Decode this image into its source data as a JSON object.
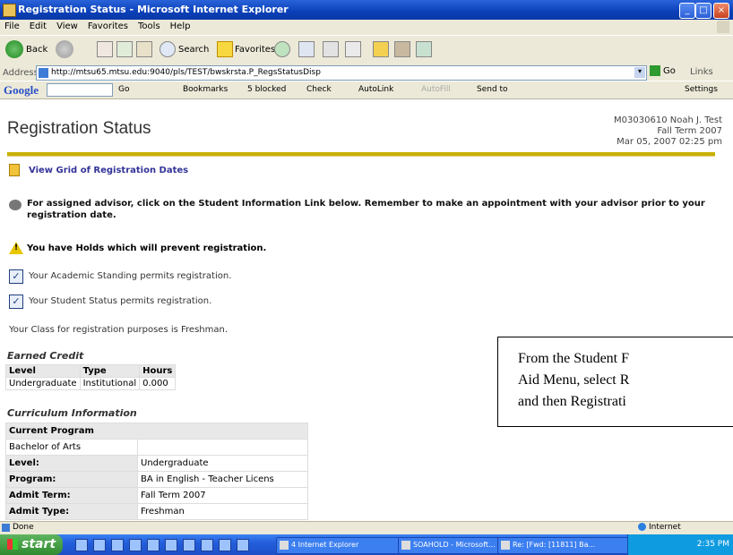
{
  "window": {
    "title": "Registration Status - Microsoft Internet Explorer"
  },
  "menu": [
    "File",
    "Edit",
    "View",
    "Favorites",
    "Tools",
    "Help"
  ],
  "toolbar": {
    "back": "Back",
    "search": "Search",
    "favorites": "Favorites"
  },
  "address": {
    "label": "Address",
    "url": "http://mtsu65.mtsu.edu:9040/pls/TEST/bwskrsta.P_RegsStatusDisp",
    "go": "Go",
    "links": "Links"
  },
  "google": {
    "logo": "Google",
    "go": "Go",
    "bookmarks": "Bookmarks",
    "blocked": "5 blocked",
    "check": "Check",
    "autolink": "AutoLink",
    "autofill": "AutoFill",
    "sendto": "Send to",
    "settings": "Settings"
  },
  "page": {
    "title": "Registration Status",
    "user": "M03030610 Noah J. Test",
    "term": "Fall Term 2007",
    "datetime": "Mar 05, 2007 02:25 pm",
    "grid_link": "View Grid of Registration Dates",
    "advisor_note": "For assigned advisor, click on the Student Information Link below. Remember to make an appointment with your advisor prior to your registration date.",
    "holds": "You have Holds which will prevent registration.",
    "standing": "Your Academic Standing permits registration.",
    "status": "Your Student Status permits registration.",
    "class": "Your Class for registration purposes is Freshman.",
    "earned_title": "Earned Credit",
    "earned_headers": [
      "Level",
      "Type",
      "Hours"
    ],
    "earned_row": [
      "Undergraduate",
      "Institutional",
      "0.000"
    ],
    "curr_title": "Curriculum Information",
    "current_program": "Current Program",
    "program_name": "Bachelor of Arts",
    "level_label": "Level:",
    "level_value": "Undergraduate",
    "program_label": "Program:",
    "program_value": "BA in English - Teacher Licens",
    "admit_term_label": "Admit Term:",
    "admit_term_value": "Fall Term 2007",
    "admit_type_label": "Admit Type:",
    "admit_type_value": "Freshman"
  },
  "callout": {
    "line1": "From the Student F",
    "line2": "Aid Menu, select R",
    "line3": "and then Registrati"
  },
  "statusbar": {
    "done": "Done",
    "zone": "Internet"
  },
  "taskbar": {
    "start": "start",
    "task1": "4 Internet Explorer",
    "task2": "SOAHOLD - Microsoft...",
    "task3": "Re: [Fwd: [11811] Ba...",
    "clock": "2:35 PM"
  }
}
